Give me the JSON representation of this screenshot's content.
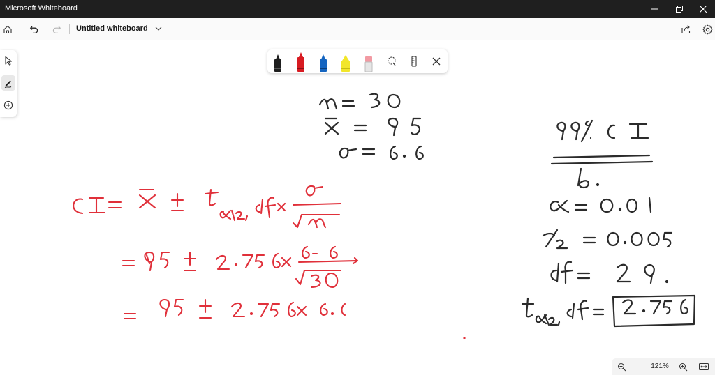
{
  "window": {
    "title": "Microsoft Whiteboard",
    "controls": [
      "minimize",
      "maximize",
      "close"
    ]
  },
  "appbar": {
    "document_title": "Untitled whiteboard",
    "icons": [
      "home-icon",
      "undo-icon",
      "redo-icon",
      "chevron-down-icon",
      "share-icon",
      "settings-icon"
    ]
  },
  "tool_rail": {
    "tools": [
      "select-tool",
      "inking-tool",
      "add-tool"
    ],
    "active": "inking-tool"
  },
  "pen_toolbar": {
    "pens": [
      {
        "name": "black-pen",
        "color": "#1e1e1e"
      },
      {
        "name": "red-pen",
        "color": "#d81b22"
      },
      {
        "name": "blue-pen",
        "color": "#1565c0"
      },
      {
        "name": "yellow-highlighter",
        "color": "#f2e62a"
      },
      {
        "name": "eraser",
        "color": "#f29aa3"
      }
    ],
    "selected": "red-pen",
    "tools": [
      "lasso-select-icon",
      "ruler-icon",
      "close-icon"
    ]
  },
  "ink": {
    "black_ink": "#2b2b2b",
    "red_ink": "#e0303a"
  },
  "zoom": {
    "level": "121%"
  }
}
